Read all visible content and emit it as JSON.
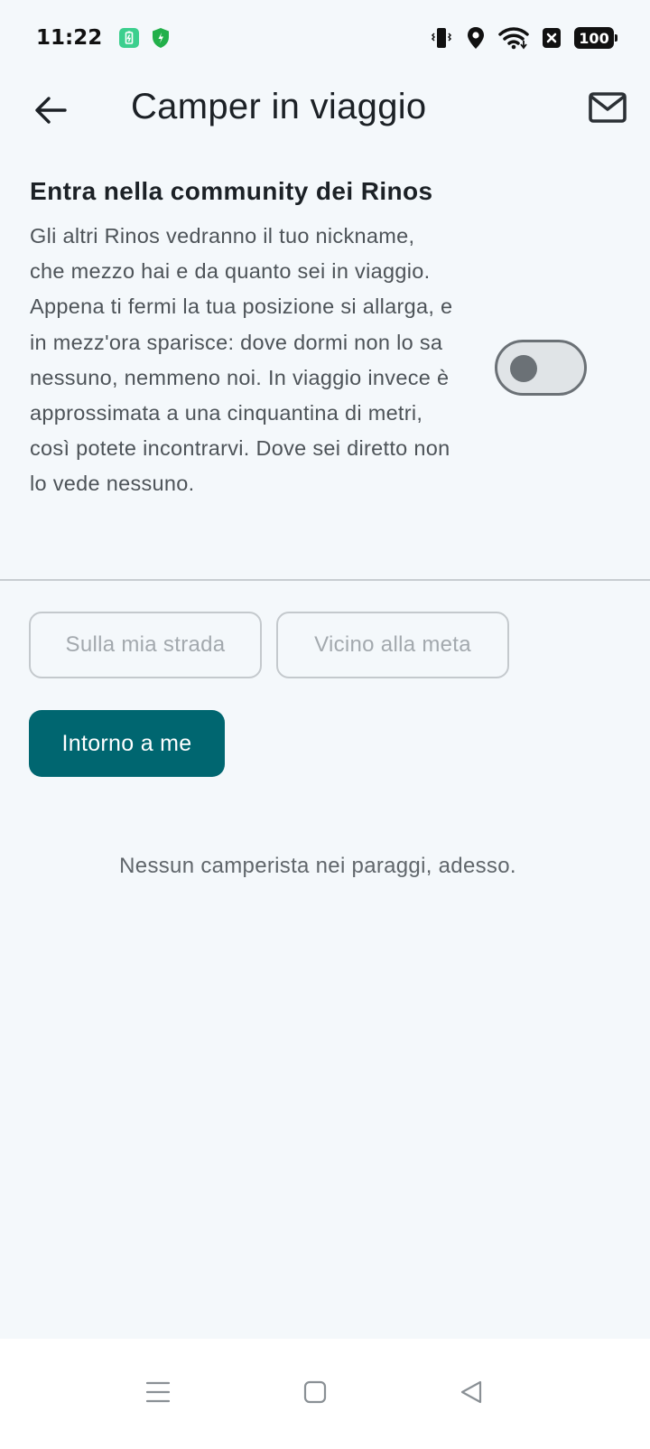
{
  "status_bar": {
    "time": "11:22",
    "battery": "100",
    "icons": [
      "battery-saver-icon",
      "shield-icon",
      "vibrate-icon",
      "location-icon",
      "wifi-icon",
      "notification-x-icon"
    ]
  },
  "app_bar": {
    "title": "Camper in viaggio",
    "back_icon": "arrow-left-icon",
    "mail_icon": "mail-icon"
  },
  "community": {
    "title": "Entra nella community dei Rinos",
    "description": "Gli altri Rinos vedranno il tuo nickname, che mezzo hai e da quanto sei in viaggio. Appena ti fermi la tua posizione si allarga, e in mezz'ora sparisce: dove dormi non lo sa nessuno, nemmeno noi. In viaggio invece è approssimata a una cinquantina di metri, così potete incontrarvi. Dove sei diretto non lo vede nessuno.",
    "toggle_on": false
  },
  "filters": {
    "on_my_road": "Sulla mia strada",
    "near_destination": "Vicino alla meta",
    "around_me": "Intorno a me",
    "selected": "around_me"
  },
  "empty_message": "Nessun camperista nei paraggi, adesso.",
  "colors": {
    "accent": "#006670",
    "background": "#f4f8fb"
  }
}
